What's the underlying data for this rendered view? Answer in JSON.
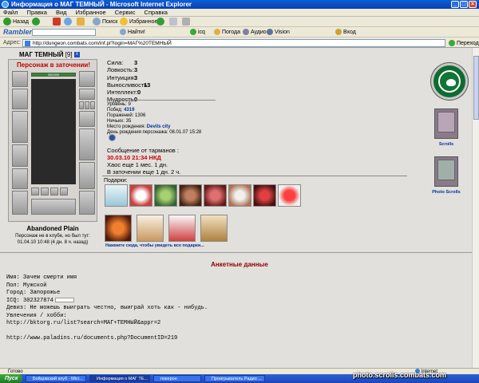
{
  "window": {
    "title": "Информация о МАГ ТЕМНЫЙ - Microsoft Internet Explorer"
  },
  "menu": [
    "Файл",
    "Правка",
    "Вид",
    "Избранное",
    "Сервис",
    "Справка"
  ],
  "toolbar": {
    "search_label": "Поиск",
    "favorites_label": "Избранное"
  },
  "ramblerbar": {
    "logo": "Rambler",
    "find_label": "Найти!",
    "icq_label": "icq",
    "weather_label": "Погода",
    "audio_label": "Аудио",
    "vision_label": "Vision",
    "login_label": "Вход"
  },
  "address": {
    "label": "Адрес:",
    "url": "http://dungeon.combats.com/inf.pl?login=МАГ%20ТЕМНЫЙ",
    "go_label": "Переход"
  },
  "character": {
    "name": "МАГ ТЕМНЫЙ",
    "level": "[9]",
    "prison_notice": "Персонаж в заточении!",
    "hp": "300/300",
    "location": "Abandoned Plain",
    "online_status": "Персонаж не в клубе, но был тут:",
    "last_seen": "01.04.10 10:48 (4 дн. 8 ч. назад)"
  },
  "stats": [
    {
      "label": "Сила:",
      "value": "3"
    },
    {
      "label": "Ловкость:",
      "value": "3"
    },
    {
      "label": "Интуиция:",
      "value": "3"
    },
    {
      "label": "Выносливость:",
      "value": "13"
    },
    {
      "label": "Интеллект:",
      "value": "0"
    },
    {
      "label": "Мудрость:",
      "value": "0"
    }
  ],
  "extra": {
    "level_line": "Уровень: 9",
    "wins_label": "Побед: ",
    "wins": "4319",
    "losses_line": "Поражений: 1306",
    "draws_line": "Ничьих: 35",
    "birthplace_label": "Место рождения: ",
    "birthplace": "Devils city",
    "birthday_line": "День рождения персонажа: 08.01.07 15:28"
  },
  "message": {
    "header": "Сообщение от тарманов :",
    "time": "30.03.10 21:34 НКД",
    "line1": "Хаос еще 1 мес. 1 дн.",
    "line2": "В заточении еще 1 дн. 2 ч."
  },
  "gifts": {
    "label": "Подарки:",
    "link": "Нажмите сюда, чтобы увидеть все подарки..."
  },
  "profile": {
    "title": "Анкетные данные",
    "lines": [
      "Имя: Зачем смерти имя",
      "Пол: Мужской",
      "Город: Запорожье",
      "ICQ: 302327874",
      "Девиз: Не можешь выиграть честно, выиграй хоть как - нибудь.",
      "Увлечения / хобби:",
      "http://bktorg.ru/list?search=МАГ+ТЕМНЫЙ&appr=2",
      "",
      "http://www.paladins.ru/documents.php?DocumentID=219"
    ]
  },
  "right": {
    "scrolls_label": "Scrolls",
    "photo_scrolls_label": "Photo Scrolls"
  },
  "statusbar": {
    "status": "Готово",
    "zone": "Internet"
  },
  "taskbar": {
    "start": "Пуск",
    "tasks": [
      "Бойцовский клуб - Micr...",
      "Информация о МАГ ТЕ...",
      "покерон",
      "Проигрыватель Радио ..."
    ]
  },
  "watermark": "photo.scrolls.combats.com"
}
